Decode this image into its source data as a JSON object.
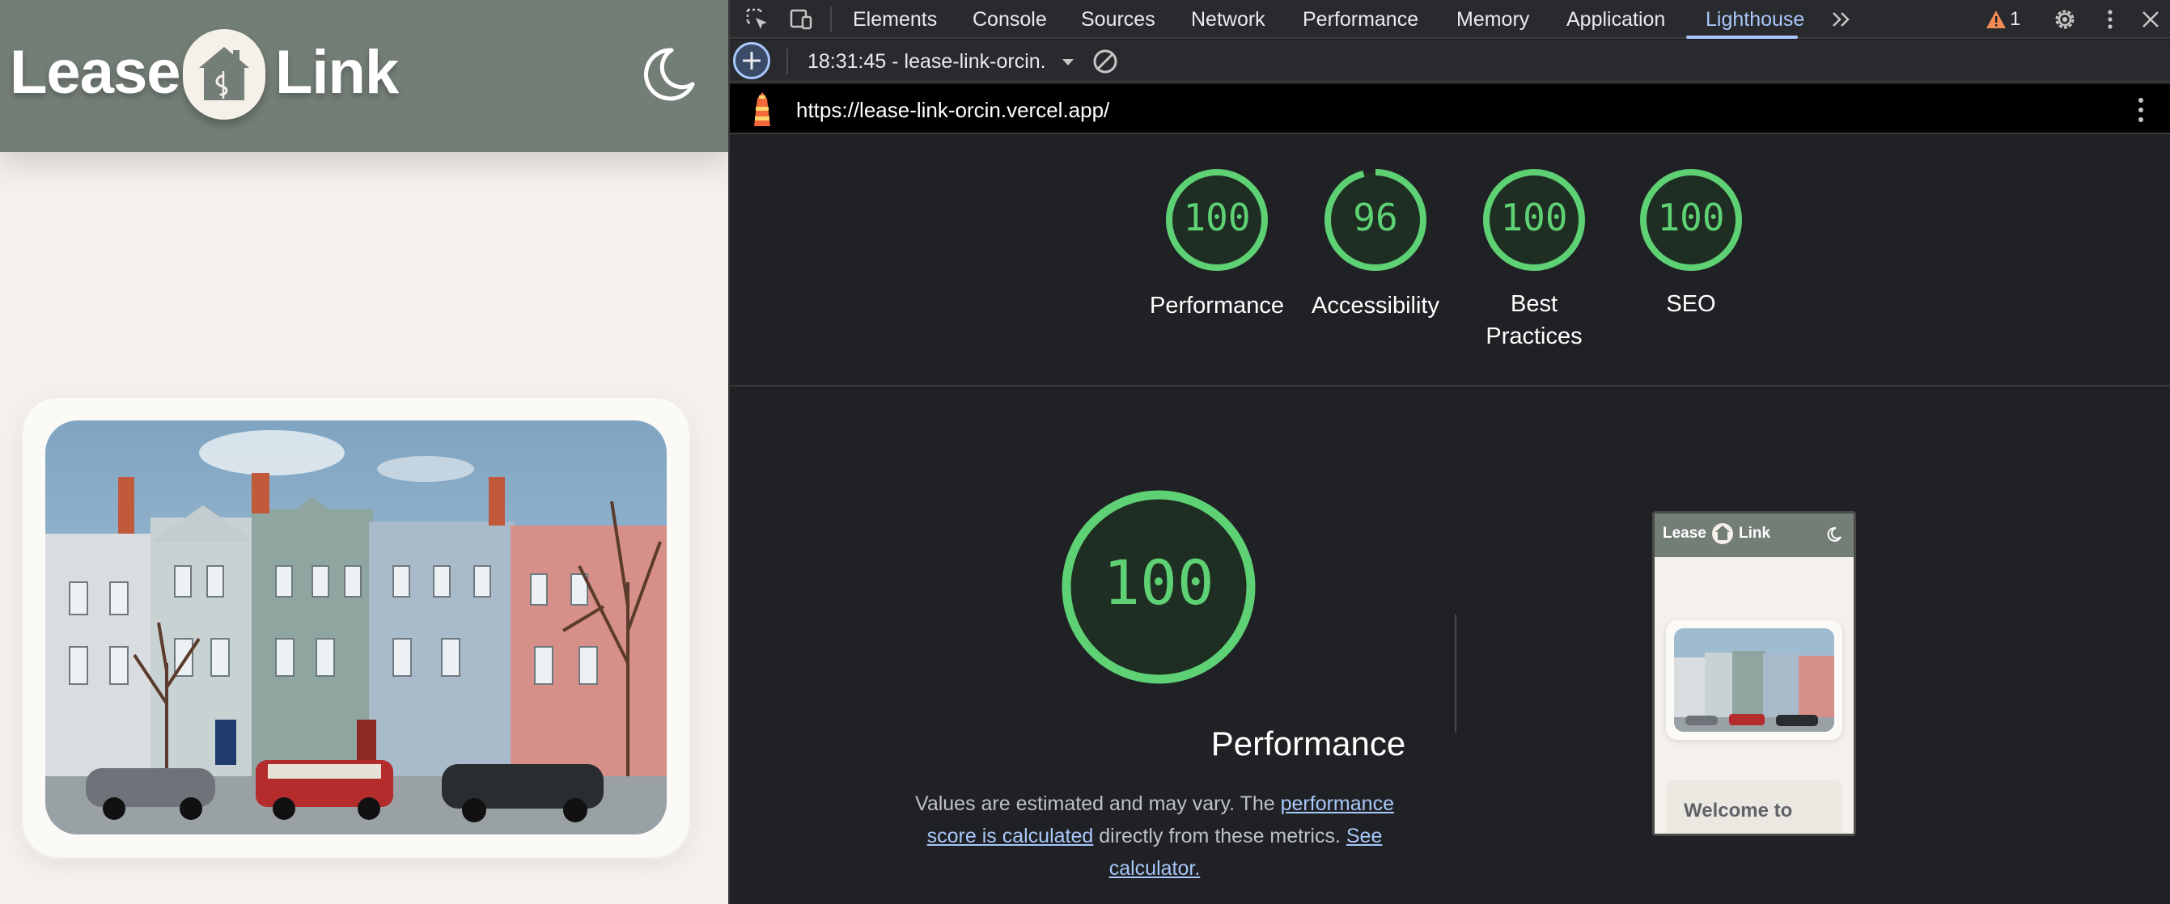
{
  "site": {
    "logo_word_1": "Lease",
    "logo_word_2": "Link",
    "welcome_text": "Welcome to",
    "header_color": "#737e76",
    "background_color": "#f4f1ec"
  },
  "devtools": {
    "tabs": [
      {
        "label": "Elements"
      },
      {
        "label": "Console"
      },
      {
        "label": "Sources"
      },
      {
        "label": "Network"
      },
      {
        "label": "Performance"
      },
      {
        "label": "Memory"
      },
      {
        "label": "Application"
      },
      {
        "label": "Lighthouse"
      }
    ],
    "active_tab": "Lighthouse",
    "issues_count": "1",
    "report_select": "18:31:45 - lease-link-orcin.",
    "report_url": "https://lease-link-orcin.vercel.app/",
    "accent_color": "#a8c7fa",
    "score_color": "#5ed174"
  },
  "scores": [
    {
      "value": "100",
      "fraction": 1.0,
      "label": "Performance"
    },
    {
      "value": "96",
      "fraction": 0.96,
      "label": "Accessibility"
    },
    {
      "value": "100",
      "fraction": 1.0,
      "label": "Best Practices"
    },
    {
      "value": "100",
      "fraction": 1.0,
      "label": "SEO"
    }
  ],
  "performance": {
    "score": "100",
    "fraction": 1.0,
    "title": "Performance",
    "desc_pre": "Values are estimated and may vary. The ",
    "link_1": "performance score is calculated",
    "desc_mid": " directly from these metrics. ",
    "link_2": "See calculator."
  }
}
